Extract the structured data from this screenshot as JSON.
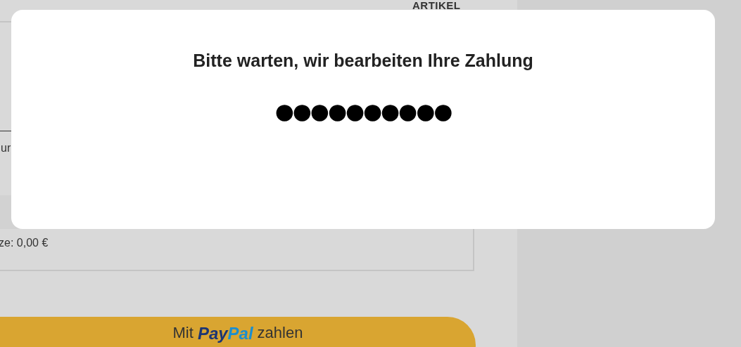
{
  "page": {
    "column_header": "ARTIKEL",
    "cut_text": "ur",
    "total_line": "ze: 0,00 €"
  },
  "paypal_button": {
    "prefix": "Mit",
    "brand_pay": "Pay",
    "brand_pal": "Pal",
    "suffix": "zahlen"
  },
  "dialog": {
    "title": "Bitte warten, wir bearbeiten Ihre Zahlung",
    "progress": "●●●●●●●●●●"
  }
}
